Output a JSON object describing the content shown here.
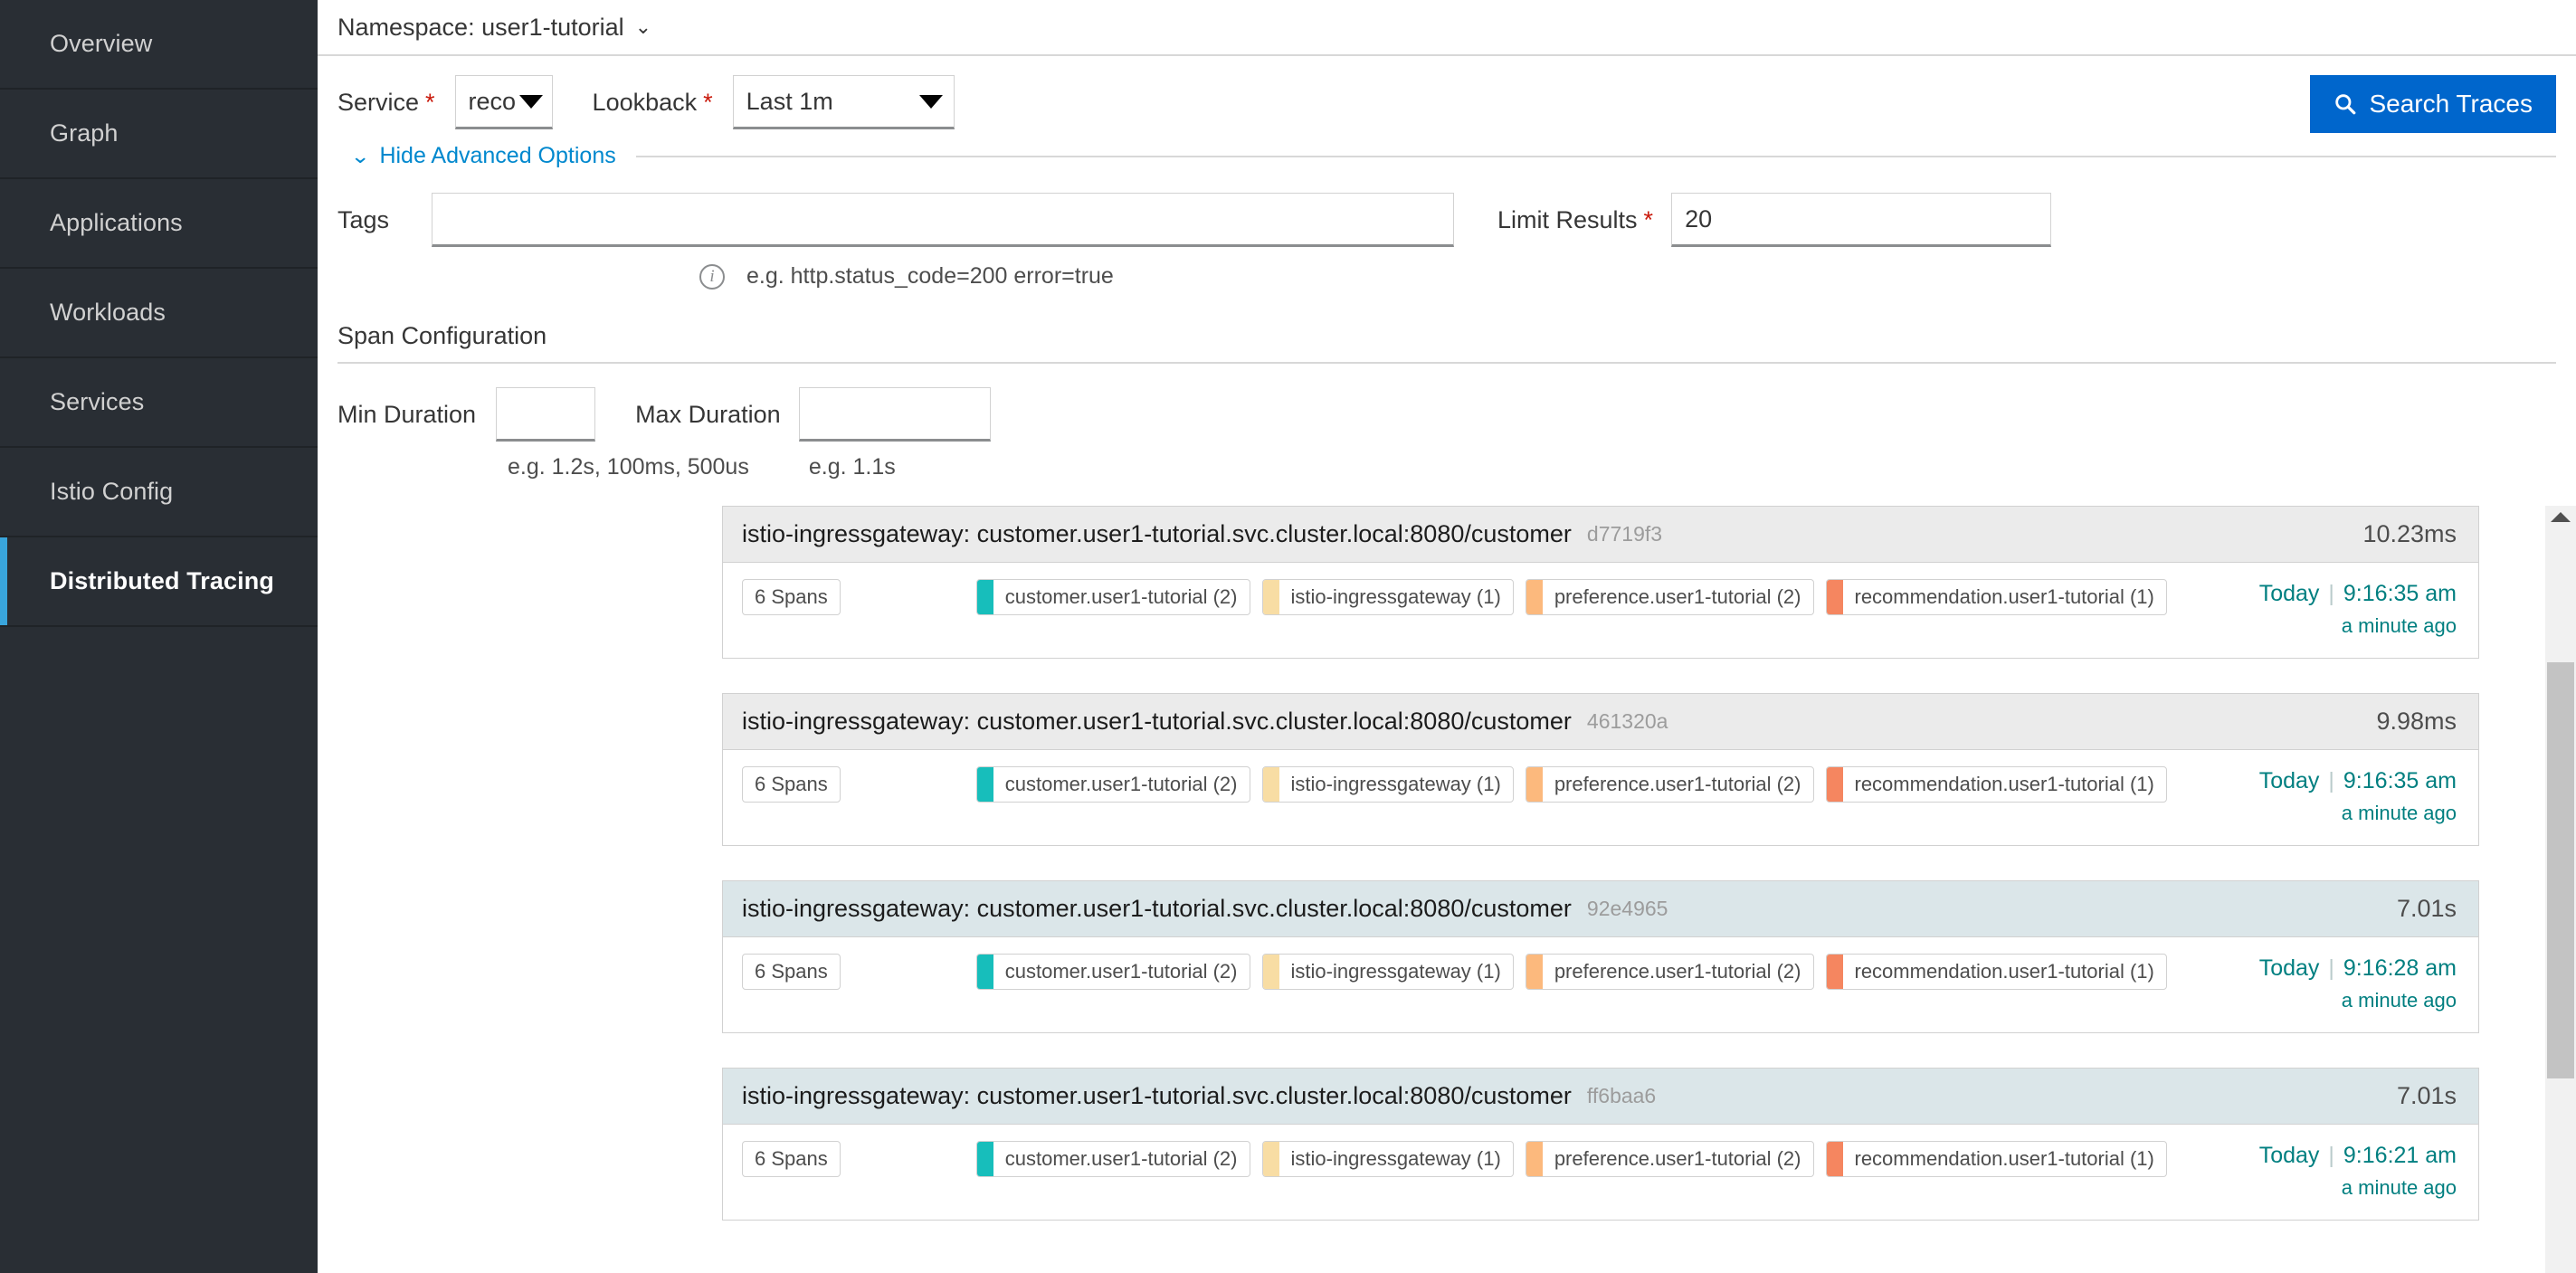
{
  "sidebar": {
    "items": [
      {
        "label": "Overview",
        "active": false
      },
      {
        "label": "Graph",
        "active": false
      },
      {
        "label": "Applications",
        "active": false
      },
      {
        "label": "Workloads",
        "active": false
      },
      {
        "label": "Services",
        "active": false
      },
      {
        "label": "Istio Config",
        "active": false
      },
      {
        "label": "Distributed Tracing",
        "active": true
      }
    ]
  },
  "header": {
    "namespace_label": "Namespace: user1-tutorial",
    "caret": "⌄"
  },
  "search_form": {
    "service_label": "Service",
    "service_value": "reco",
    "lookback_label": "Lookback",
    "lookback_value": "Last 1m",
    "required_mark": "*",
    "search_button": "Search Traces",
    "advanced_toggle": "Hide Advanced Options",
    "tags_label": "Tags",
    "tags_value": "",
    "tags_hint": "e.g. http.status_code=200 error=true",
    "limit_label": "Limit Results",
    "limit_value": "20",
    "span_config_title": "Span Configuration",
    "min_duration_label": "Min Duration",
    "min_duration_value": "",
    "min_duration_hint": "e.g. 1.2s, 100ms, 500us",
    "max_duration_label": "Max Duration",
    "max_duration_value": "",
    "max_duration_hint": "e.g. 1.1s"
  },
  "colors": {
    "accent_blue": "#0066cc",
    "link_blue": "#0088ce",
    "teal": "#007f80",
    "required_red": "#c9190b",
    "active_bar": "#39a5dc",
    "sidebar_bg": "#292e34",
    "svc_customer": "#17bebb",
    "svc_ingressgateway": "#f8dda4",
    "svc_preference": "#fcb97d",
    "svc_recommendation": "#f58660"
  },
  "results": {
    "traces": [
      {
        "name": "istio-ingressgateway: customer.user1-tutorial.svc.cluster.local:8080/customer",
        "id": "d7719f3",
        "duration": "10.23ms",
        "head_style": "gray",
        "spans": "6 Spans",
        "services": [
          {
            "label": "customer.user1-tutorial (2)",
            "color": "#17bebb"
          },
          {
            "label": "istio-ingressgateway (1)",
            "color": "#f8dda4"
          },
          {
            "label": "preference.user1-tutorial (2)",
            "color": "#fcb97d"
          },
          {
            "label": "recommendation.user1-tutorial (1)",
            "color": "#f58660"
          }
        ],
        "day": "Today",
        "time": "9:16:35 am",
        "relative": "a minute ago"
      },
      {
        "name": "istio-ingressgateway: customer.user1-tutorial.svc.cluster.local:8080/customer",
        "id": "461320a",
        "duration": "9.98ms",
        "head_style": "gray",
        "spans": "6 Spans",
        "services": [
          {
            "label": "customer.user1-tutorial (2)",
            "color": "#17bebb"
          },
          {
            "label": "istio-ingressgateway (1)",
            "color": "#f8dda4"
          },
          {
            "label": "preference.user1-tutorial (2)",
            "color": "#fcb97d"
          },
          {
            "label": "recommendation.user1-tutorial (1)",
            "color": "#f58660"
          }
        ],
        "day": "Today",
        "time": "9:16:35 am",
        "relative": "a minute ago"
      },
      {
        "name": "istio-ingressgateway: customer.user1-tutorial.svc.cluster.local:8080/customer",
        "id": "92e4965",
        "duration": "7.01s",
        "head_style": "blue",
        "spans": "6 Spans",
        "services": [
          {
            "label": "customer.user1-tutorial (2)",
            "color": "#17bebb"
          },
          {
            "label": "istio-ingressgateway (1)",
            "color": "#f8dda4"
          },
          {
            "label": "preference.user1-tutorial (2)",
            "color": "#fcb97d"
          },
          {
            "label": "recommendation.user1-tutorial (1)",
            "color": "#f58660"
          }
        ],
        "day": "Today",
        "time": "9:16:28 am",
        "relative": "a minute ago"
      },
      {
        "name": "istio-ingressgateway: customer.user1-tutorial.svc.cluster.local:8080/customer",
        "id": "ff6baa6",
        "duration": "7.01s",
        "head_style": "blue",
        "spans": "6 Spans",
        "services": [
          {
            "label": "customer.user1-tutorial (2)",
            "color": "#17bebb"
          },
          {
            "label": "istio-ingressgateway (1)",
            "color": "#f8dda4"
          },
          {
            "label": "preference.user1-tutorial (2)",
            "color": "#fcb97d"
          },
          {
            "label": "recommendation.user1-tutorial (1)",
            "color": "#f58660"
          }
        ],
        "day": "Today",
        "time": "9:16:21 am",
        "relative": "a minute ago"
      }
    ]
  }
}
